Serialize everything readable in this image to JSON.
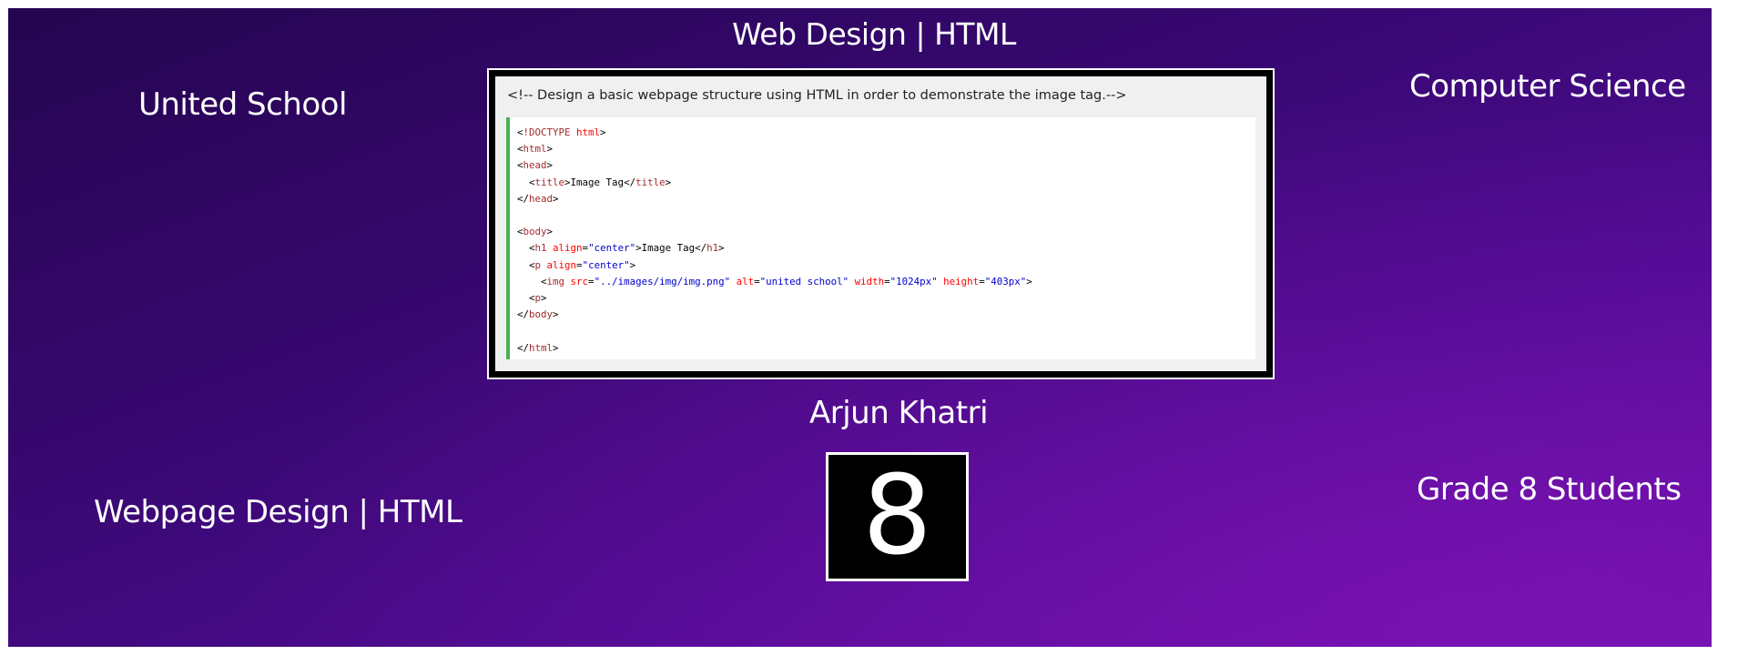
{
  "title": "Web Design | HTML",
  "school": "United School",
  "subject": "Computer Science",
  "author": "Arjun Khatri",
  "topic": "Webpage Design | HTML",
  "audience": "Grade 8 Students",
  "grade_badge": "8",
  "code_panel": {
    "comment": "<!-- Design a basic webpage structure using HTML in order to demonstrate the image tag.-->",
    "lines": {
      "l1": {
        "p1": "<",
        "tag": "!DOCTYPE",
        "attr": " html",
        "p2": ">"
      },
      "l2": {
        "p1": "<",
        "tag": "html",
        "p2": ">"
      },
      "l3": {
        "p1": "<",
        "tag": "head",
        "p2": ">"
      },
      "l4": {
        "p1": "  <",
        "tag": "title",
        "p2": ">",
        "text": "Image Tag",
        "p3": "</",
        "tag2": "title",
        "p4": ">"
      },
      "l5": {
        "p1": "</",
        "tag": "head",
        "p2": ">"
      },
      "l7": {
        "p1": "<",
        "tag": "body",
        "p2": ">"
      },
      "l8": {
        "p1": "  <",
        "tag": "h1",
        "attr": " align",
        "eq": "=",
        "val": "\"center\"",
        "p2": ">",
        "text": "Image Tag",
        "p3": "</",
        "tag2": "h1",
        "p4": ">"
      },
      "l9": {
        "p1": "  <",
        "tag": "p",
        "attr": " align",
        "eq": "=",
        "val": "\"center\"",
        "p2": ">"
      },
      "l10": {
        "p1": "    <",
        "tag": "img",
        "a1": " src",
        "e1": "=",
        "v1": "\"../images/img/img.png\"",
        "a2": " alt",
        "e2": "=",
        "v2": "\"united school\"",
        "a3": " width",
        "e3": "=",
        "v3": "\"1024px\"",
        "a4": " height",
        "e4": "=",
        "v4": "\"403px\"",
        "p2": ">"
      },
      "l11": {
        "p1": "  <",
        "tag": "p",
        "p2": ">"
      },
      "l12": {
        "p1": "</",
        "tag": "body",
        "p2": ">"
      },
      "l14": {
        "p1": "</",
        "tag": "html",
        "p2": ">"
      }
    }
  },
  "colors": {
    "background_top": "#24054f",
    "background_bottom": "#6a10a8",
    "code_tag": "#a52a2a",
    "code_attr": "#ff0000",
    "code_value": "#0000cd",
    "code_rule": "#4caf50"
  }
}
